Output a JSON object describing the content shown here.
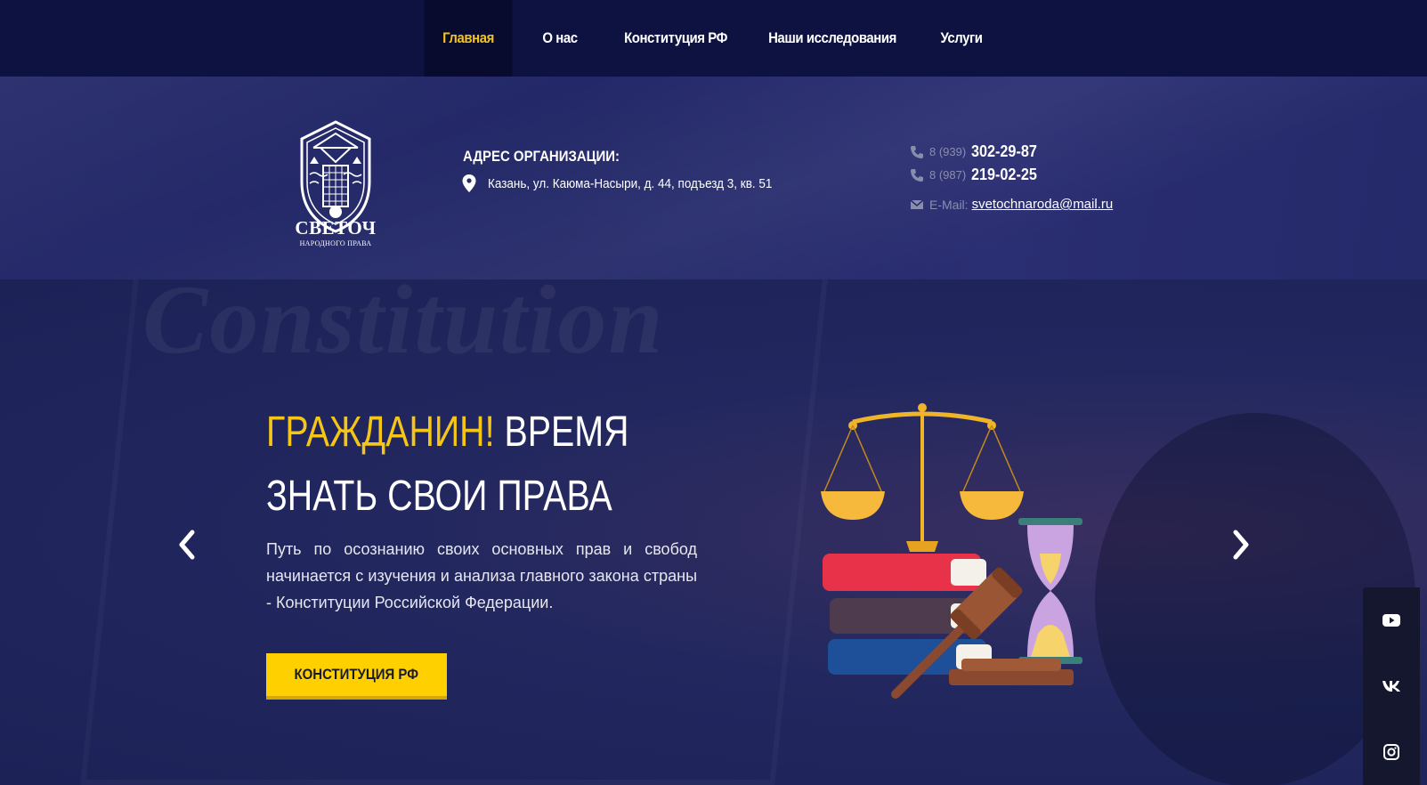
{
  "nav": {
    "items": [
      {
        "label": "Главная",
        "active": true
      },
      {
        "label": "О нас",
        "active": false
      },
      {
        "label": "Конституция РФ",
        "active": false
      },
      {
        "label": "Наши исследования",
        "active": false
      },
      {
        "label": "Услуги",
        "active": false
      }
    ]
  },
  "header": {
    "logo_title": "СВЕТОЧ",
    "logo_subtitle": "НАРОДНОГО ПРАВА",
    "address_label": "АДРЕС ОРГАНИЗАЦИИ:",
    "address": "Казань, ул. Каюма-Насыри, д. 44, подъезд 3, кв. 51",
    "phones": [
      {
        "code": "8 (939)",
        "number": "302-29-87"
      },
      {
        "code": "8 (987)",
        "number": "219-02-25"
      }
    ],
    "email_label": "E-Mail:",
    "email": "svetochnaroda@mail.ru"
  },
  "hero": {
    "watermark": "Constitution",
    "headline_accent": "ГРАЖДАНИН!",
    "headline_rest": "ВРЕМЯ",
    "headline_line2": "ЗНАТЬ СВОИ ПРАВА",
    "lead": "Путь по осознанию своих основных прав и свобод начинается с изучения и анализа главного закона страны - Конституции Российской Федерации.",
    "cta_label": "КОНСТИТУЦИЯ РФ"
  },
  "social": {
    "items": [
      {
        "icon": "youtube-icon"
      },
      {
        "icon": "vk-icon"
      },
      {
        "icon": "instagram-icon"
      }
    ]
  },
  "colors": {
    "accent": "#f5c518",
    "nav_bg": "#0d1240",
    "band_bg": "#262a6a",
    "hero_bg": "#22285f",
    "button": "#ffd000"
  }
}
